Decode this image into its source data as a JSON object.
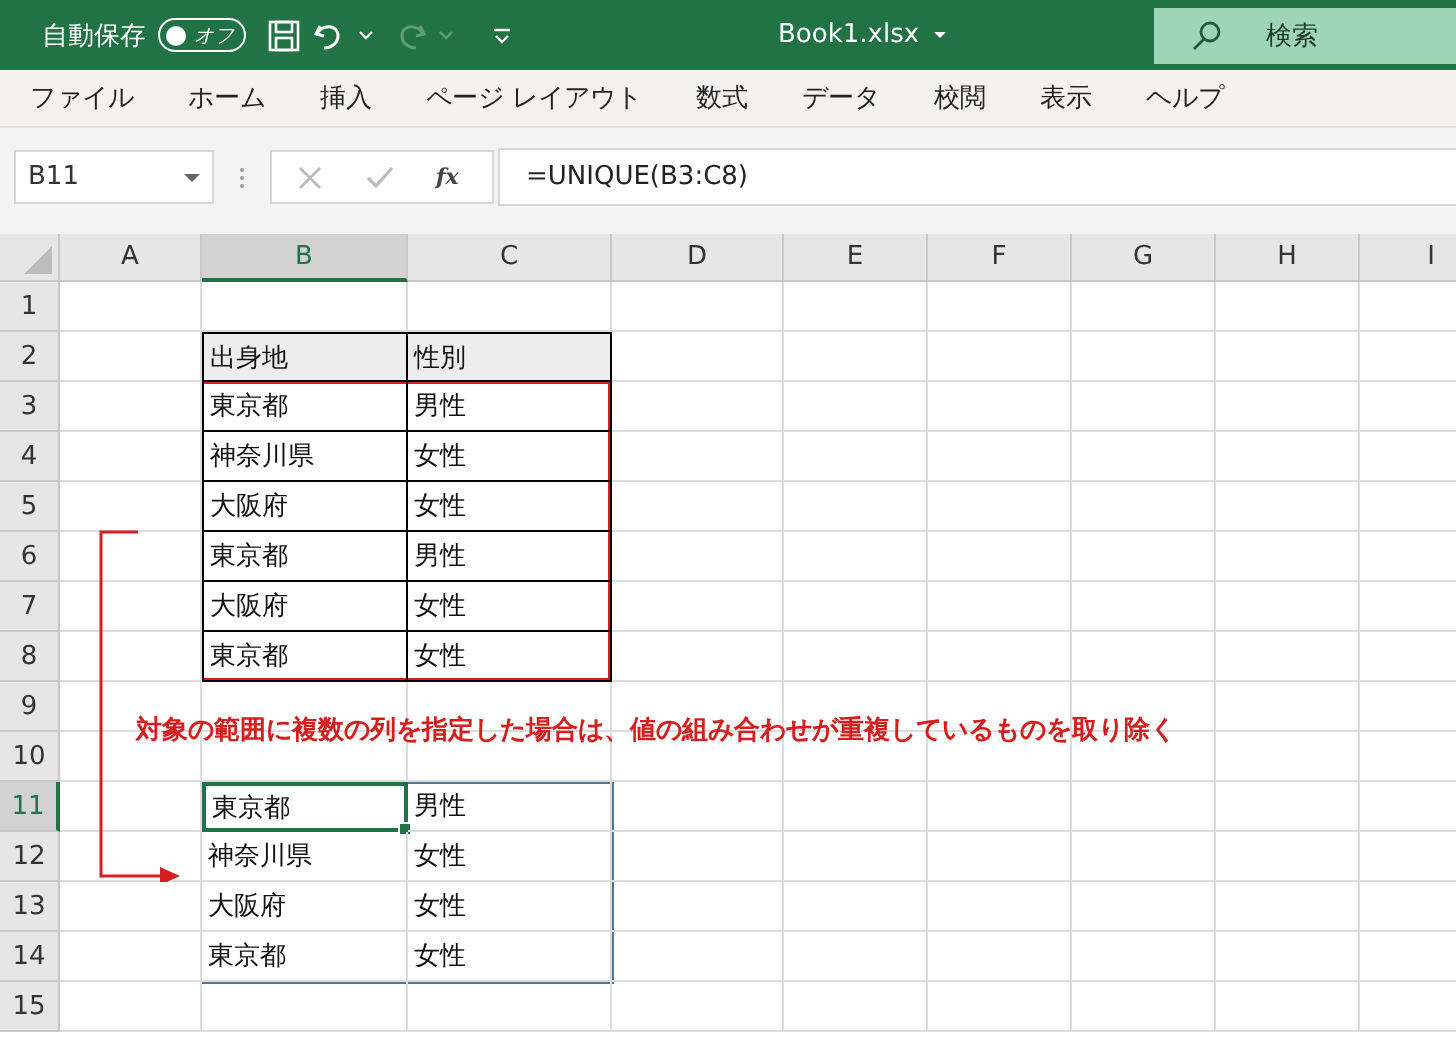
{
  "title_bar": {
    "autosave_label": "自動保存",
    "autosave_toggle": {
      "label": "オフ",
      "on": false
    },
    "redo_disabled": true,
    "file_name": "Book1.xlsx",
    "search_placeholder": "検索"
  },
  "ribbon_tabs": [
    {
      "label": "ファイル"
    },
    {
      "label": "ホーム"
    },
    {
      "label": "挿入"
    },
    {
      "label": "ページ レイアウト"
    },
    {
      "label": "数式"
    },
    {
      "label": "データ"
    },
    {
      "label": "校閲"
    },
    {
      "label": "表示"
    },
    {
      "label": "ヘルプ"
    }
  ],
  "formula_bar": {
    "name_box": "B11",
    "function_button": "fx",
    "formula": "=UNIQUE(B3:C8)"
  },
  "sheet": {
    "columns": [
      {
        "label": "A",
        "selected": false
      },
      {
        "label": "B",
        "selected": true
      },
      {
        "label": "C",
        "selected": false
      },
      {
        "label": "D",
        "selected": false
      },
      {
        "label": "E",
        "selected": false
      },
      {
        "label": "F",
        "selected": false
      },
      {
        "label": "G",
        "selected": false
      },
      {
        "label": "H",
        "selected": false
      },
      {
        "label": "I",
        "selected": false
      }
    ],
    "rows": [
      {
        "label": "1",
        "selected": false,
        "kind": "empty"
      },
      {
        "label": "2",
        "selected": false,
        "kind": "header",
        "cells": [
          {
            "text": "出身地",
            "selected": false
          },
          {
            "text": "性別",
            "selected": false
          }
        ]
      },
      {
        "label": "3",
        "selected": false,
        "kind": "source",
        "cells": [
          {
            "text": "東京都",
            "selected": false
          },
          {
            "text": "男性",
            "selected": false
          }
        ]
      },
      {
        "label": "4",
        "selected": false,
        "kind": "source",
        "cells": [
          {
            "text": "神奈川県",
            "selected": false
          },
          {
            "text": "女性",
            "selected": false
          }
        ]
      },
      {
        "label": "5",
        "selected": false,
        "kind": "source",
        "cells": [
          {
            "text": "大阪府",
            "selected": false
          },
          {
            "text": "女性",
            "selected": false
          }
        ]
      },
      {
        "label": "6",
        "selected": false,
        "kind": "source",
        "cells": [
          {
            "text": "東京都",
            "selected": false
          },
          {
            "text": "男性",
            "selected": false
          }
        ]
      },
      {
        "label": "7",
        "selected": false,
        "kind": "source",
        "cells": [
          {
            "text": "大阪府",
            "selected": false
          },
          {
            "text": "女性",
            "selected": false
          }
        ]
      },
      {
        "label": "8",
        "selected": false,
        "kind": "source",
        "cells": [
          {
            "text": "東京都",
            "selected": false
          },
          {
            "text": "女性",
            "selected": false
          }
        ]
      },
      {
        "label": "9",
        "selected": false,
        "kind": "empty"
      },
      {
        "label": "10",
        "selected": false,
        "kind": "empty"
      },
      {
        "label": "11",
        "selected": true,
        "kind": "result",
        "cells": [
          {
            "text": "東京都",
            "selected": true
          },
          {
            "text": "男性",
            "selected": false
          }
        ]
      },
      {
        "label": "12",
        "selected": false,
        "kind": "result",
        "cells": [
          {
            "text": "神奈川県",
            "selected": false
          },
          {
            "text": "女性",
            "selected": false
          }
        ]
      },
      {
        "label": "13",
        "selected": false,
        "kind": "result",
        "cells": [
          {
            "text": "大阪府",
            "selected": false
          },
          {
            "text": "女性",
            "selected": false
          }
        ]
      },
      {
        "label": "14",
        "selected": false,
        "kind": "result",
        "cells": [
          {
            "text": "東京都",
            "selected": false
          },
          {
            "text": "女性",
            "selected": false
          }
        ]
      },
      {
        "label": "15",
        "selected": false,
        "kind": "empty"
      }
    ],
    "annotation": "対象の範囲に複数の列を指定した場合は、値の組み合わせが重複しているものを取り除く"
  }
}
